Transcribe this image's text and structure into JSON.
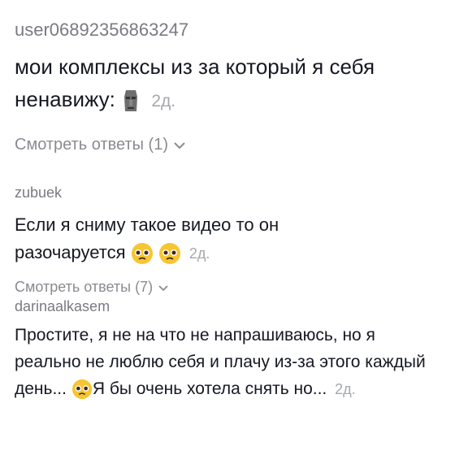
{
  "comments": [
    {
      "username": "user06892356863247",
      "text": "мои комплексы из за который я себя ненавижу:",
      "emoji": [
        "moai-emoji"
      ],
      "time": "2д.",
      "replies_label": "Смотреть ответы (1)"
    },
    {
      "username": "zubuek",
      "text": "Если я сниму такое видео то он разочаруется",
      "emoji": [
        "pleading-face-emoji",
        "pleading-face-emoji"
      ],
      "time": "2д.",
      "replies_label": "Смотреть ответы (7)"
    },
    {
      "username": "darinaalkasem",
      "text_part1": "Простите, я не на что не напрашиваюсь, но я реально не люблю себя и плачу из-за этого каждый день...",
      "emoji": [
        "pleading-face-emoji"
      ],
      "text_part2": "Я бы очень хотела снять но...",
      "time": "2д."
    }
  ],
  "colors": {
    "text": "#161823",
    "username": "#7a7b81",
    "meta": "#a6a8ad"
  }
}
